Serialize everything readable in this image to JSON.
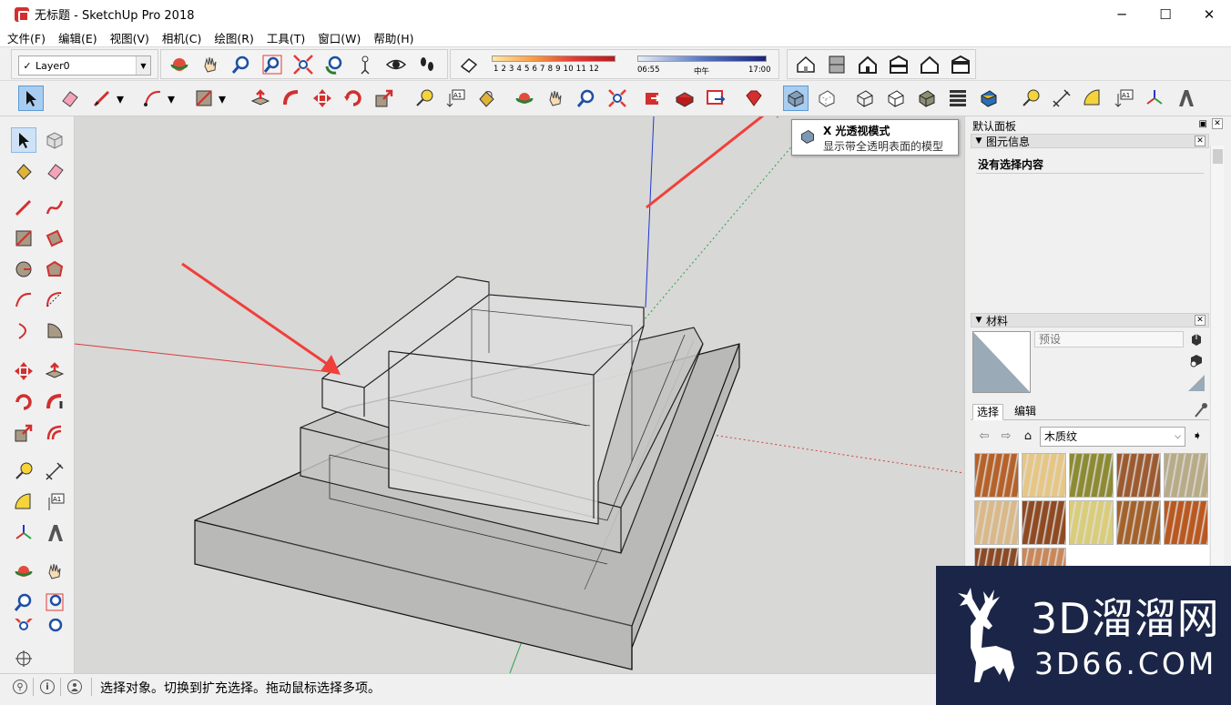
{
  "window": {
    "title": "无标题 - SketchUp Pro 2018",
    "minimize": "─",
    "maximize": "☐",
    "close": "✕"
  },
  "menu": [
    "文件(F)",
    "编辑(E)",
    "视图(V)",
    "相机(C)",
    "绘图(R)",
    "工具(T)",
    "窗口(W)",
    "帮助(H)"
  ],
  "layer": {
    "check": "✓",
    "name": "Layer0",
    "arrow": "▼"
  },
  "shadow": {
    "months": "1 2 3 4 5 6 7 8 9 10 11 12",
    "time_start": "06:55",
    "time_mid": "中午",
    "time_end": "17:00"
  },
  "tooltip": {
    "title": "X 光透视模式",
    "description": "显示带全透明表面的模型"
  },
  "tray": {
    "title": "默认面板",
    "pin": "📌",
    "close": "✕",
    "entity_info": {
      "title": "图元信息",
      "toggle": "▼",
      "close": "✕",
      "content": "没有选择内容"
    },
    "materials": {
      "title": "材料",
      "toggle": "▼",
      "close": "✕",
      "name_placeholder": "预设",
      "tabs": [
        "选择",
        "编辑"
      ],
      "collection": "木质纹",
      "collection_arrow": "⌵",
      "swatch_colors": [
        "#b5622a",
        "#e6c684",
        "#8c8a33",
        "#9c5a30",
        "#b7ab88",
        "#d9b98a",
        "#8e4a22",
        "#d9cd7a",
        "#a3622b",
        "#b9581f",
        "#8a4a25",
        "#c98759"
      ]
    }
  },
  "status": {
    "text": "选择对象。切换到扩充选择。拖动鼠标选择多项。",
    "info": "i",
    "geo": "⚲"
  },
  "watermark": {
    "big": "3D溜溜网",
    "small": "3D66.COM"
  },
  "colors": {
    "active_blue": "#a9cdf0",
    "red_axis": "#d93b3b",
    "green_axis": "#2ea043",
    "blue_axis": "#2136d1",
    "arrow_red": "#f0403a"
  }
}
